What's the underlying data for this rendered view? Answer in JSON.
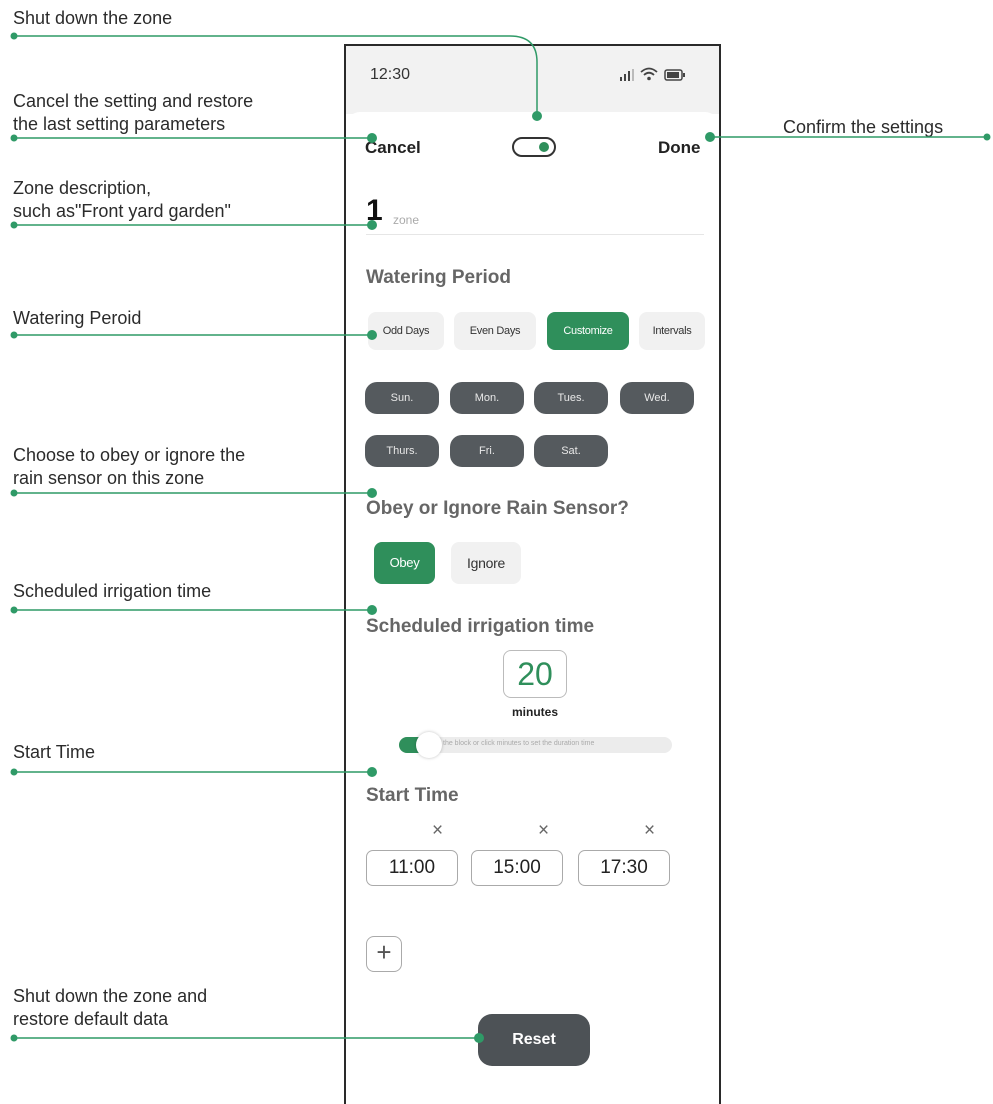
{
  "annotations": {
    "shut_down_zone": "Shut down the zone",
    "cancel_line1": "Cancel the setting and restore",
    "cancel_line2": "the last setting parameters",
    "confirm": "Confirm the settings",
    "zone_desc_line1": "Zone description,",
    "zone_desc_line2": "such as\"Front yard garden\"",
    "watering_period": "Watering Peroid",
    "rain_line1": "Choose to obey or ignore the",
    "rain_line2": "rain sensor on this zone",
    "scheduled": "Scheduled irrigation time",
    "start_time": "Start Time",
    "reset_line1": "Shut down the zone and",
    "reset_line2": "restore default data"
  },
  "status_bar": {
    "time": "12:30"
  },
  "header": {
    "cancel": "Cancel",
    "done": "Done",
    "zone_enabled": true
  },
  "zone": {
    "number": "1",
    "placeholder": "zone"
  },
  "watering_period": {
    "title": "Watering Period",
    "options": [
      "Odd Days",
      "Even Days",
      "Customize",
      "Intervals"
    ],
    "selected": "Customize",
    "days": [
      "Sun.",
      "Mon.",
      "Tues.",
      "Wed.",
      "Thurs.",
      "Fri.",
      "Sat."
    ]
  },
  "rain_sensor": {
    "title": "Obey or Ignore Rain Sensor?",
    "obey": "Obey",
    "ignore": "Ignore",
    "selected": "Obey"
  },
  "irrigation": {
    "title": "Scheduled irrigation time",
    "value": "20",
    "unit": "minutes",
    "hint": "the block or click minutes to set the duration time"
  },
  "start_time": {
    "title": "Start Time",
    "times": [
      "11:00",
      "15:00",
      "17:30"
    ],
    "remove_symbol": "×",
    "add_symbol": "+"
  },
  "reset": "Reset",
  "colors": {
    "accent": "#2f8f5b",
    "line": "#2f9a67",
    "dark_chip": "#555a5e"
  }
}
